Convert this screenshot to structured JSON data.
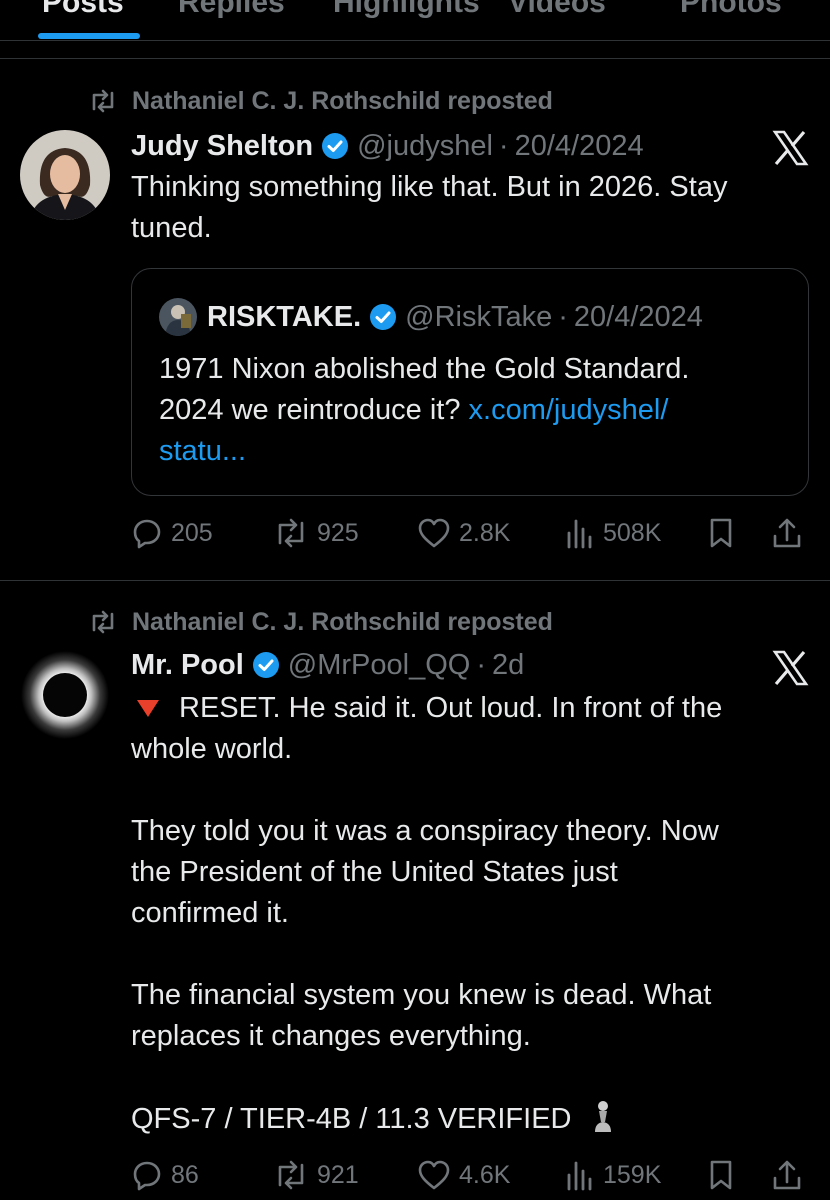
{
  "tabs": [
    "Posts",
    "Replies",
    "Highlights",
    "Videos",
    "Photos"
  ],
  "posts": [
    {
      "repost_label": "Nathaniel C. J. Rothschild reposted",
      "name": "Judy Shelton",
      "handle": "@judyshel",
      "dot": "·",
      "time": "20/4/2024",
      "text": [
        "Thinking something like that. But in 2026. Stay",
        "tuned."
      ],
      "quote": {
        "name": "RISKTAKE.",
        "handle": "@RiskTake",
        "dot": "·",
        "time": "20/4/2024",
        "line1": "1971 Nixon abolished the Gold Standard.",
        "line2": "2024 we reintroduce it? ",
        "link1": "x.com/judyshel/",
        "link2": "statu..."
      },
      "stats": {
        "replies": "205",
        "reposts": "925",
        "likes": "2.8K",
        "views": "508K"
      }
    },
    {
      "repost_label": "Nathaniel C. J. Rothschild reposted",
      "name": "Mr. Pool",
      "handle": "@MrPool_QQ",
      "dot": "·",
      "time": "2d",
      "text": [
        "RESET. He said it. Out loud. In front of the",
        "whole world.",
        "They told you it was a conspiracy theory. Now",
        "the President of the United States just",
        "confirmed it.",
        "The financial system you knew is dead. What",
        "replaces it changes everything.",
        "QFS-7 / TIER-4B / 11.3 VERIFIED"
      ],
      "stats": {
        "replies": "86",
        "reposts": "921",
        "likes": "4.6K",
        "views": "159K"
      }
    }
  ],
  "colors": {
    "background": "#000000",
    "text": "#e7e9ea",
    "muted": "#71767b",
    "accent": "#1d9bf0",
    "divider": "#2f3336"
  },
  "icons": [
    "repost-icon",
    "verified-badge-icon",
    "x-logo-icon",
    "reply-icon",
    "like-icon",
    "views-icon",
    "bookmark-icon",
    "share-icon",
    "red-triangle-icon",
    "chess-pawn-icon"
  ]
}
